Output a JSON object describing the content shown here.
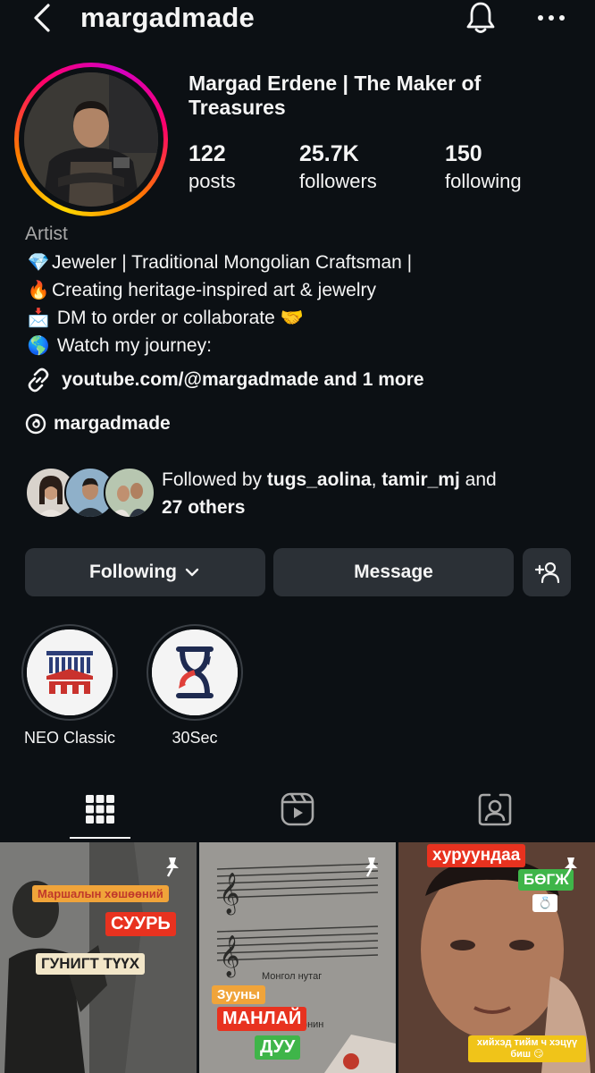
{
  "header": {
    "username": "margadmade",
    "icons": [
      "back-chevron-icon",
      "bell-icon",
      "more-icon"
    ]
  },
  "profile": {
    "display_name": "Margad Erdene | The Maker of Treasures",
    "stats": [
      {
        "value": "122",
        "label": "posts"
      },
      {
        "value": "25.7K",
        "label": "followers"
      },
      {
        "value": "150",
        "label": "following"
      }
    ],
    "category": "Artist",
    "bio": [
      {
        "emoji": "💎",
        "text": "Jeweler | Traditional Mongolian Craftsman |"
      },
      {
        "emoji": "🔥",
        "text": "Creating heritage-inspired art & jewelry"
      },
      {
        "emoji": "📩",
        "text": "DM to order or collaborate 🤝"
      },
      {
        "emoji": "🌎",
        "text": "Watch my journey:"
      }
    ],
    "link": "youtube.com/@margadmade and 1 more",
    "threads_handle": "margadmade"
  },
  "followed_by": {
    "prefix": "Followed by ",
    "user1": "tugs_aolina",
    "separator": ", ",
    "user2": "tamir_mj",
    "and_text": " and",
    "others": "27 others"
  },
  "actions": {
    "following_label": "Following",
    "message_label": "Message"
  },
  "highlights": [
    {
      "label": "NEO Classic"
    },
    {
      "label": "30Sec"
    }
  ],
  "tabs": [
    "grid-tab",
    "reels-tab",
    "tagged-tab"
  ],
  "posts": [
    {
      "tags": [
        "Маршалын хөшөөний",
        "СУУРЬ",
        "ГУНИГТ ТҮҮХ"
      ]
    },
    {
      "tags": [
        "Зууны",
        "МАНЛАЙ",
        "ДУУ"
      ],
      "bg_text": [
        "Монгол нутаг",
        "тай эрд(э)нин"
      ]
    },
    {
      "tags": [
        "хуруундаа",
        "БӨГЖ",
        "💍",
        "хийхэд тийм ч хэцүү биш 😏"
      ]
    }
  ],
  "colors": {
    "background": "#0c1014",
    "button": "#2b3036",
    "muted": "#a8a8a8",
    "tag_red": "#e8321f",
    "tag_orange": "#f0a43a",
    "tag_green": "#3fb549"
  }
}
